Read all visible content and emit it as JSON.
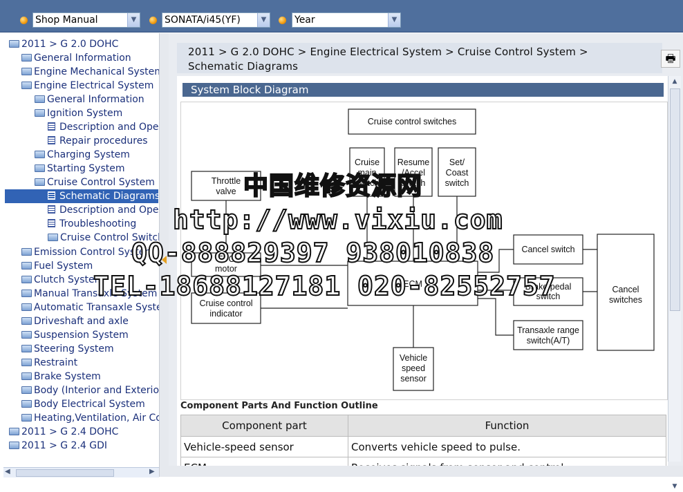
{
  "toolbar": {
    "manual_select": "Shop Manual",
    "model_select": "SONATA/i45(YF)",
    "year_select": "Year"
  },
  "tree": [
    {
      "label": "2011 > G 2.0 DOHC",
      "icon": "folder-icon"
    },
    {
      "label": "General Information",
      "icon": "folder-icon"
    },
    {
      "label": "Engine Mechanical System",
      "icon": "folder-icon"
    },
    {
      "label": "Engine Electrical System",
      "icon": "folder-open-icon"
    },
    {
      "label": "General Information",
      "icon": "folder-icon"
    },
    {
      "label": "Ignition System",
      "icon": "folder-open-icon"
    },
    {
      "label": "Description and Oper",
      "icon": "document-icon"
    },
    {
      "label": "Repair procedures",
      "icon": "document-icon"
    },
    {
      "label": "Charging System",
      "icon": "folder-icon"
    },
    {
      "label": "Starting System",
      "icon": "folder-icon"
    },
    {
      "label": "Cruise Control System",
      "icon": "folder-open-icon"
    },
    {
      "label": "Schematic Diagrams",
      "icon": "document-icon"
    },
    {
      "label": "Description and Oper",
      "icon": "document-icon"
    },
    {
      "label": "Troubleshooting",
      "icon": "document-icon"
    },
    {
      "label": "Cruise Control Switch",
      "icon": "folder-icon"
    },
    {
      "label": "Emission Control System",
      "icon": "folder-icon"
    },
    {
      "label": "Fuel System",
      "icon": "folder-icon"
    },
    {
      "label": "Clutch System",
      "icon": "folder-icon"
    },
    {
      "label": "Manual Transaxle System",
      "icon": "folder-icon"
    },
    {
      "label": "Automatic Transaxle System",
      "icon": "folder-icon"
    },
    {
      "label": "Driveshaft and axle",
      "icon": "folder-icon"
    },
    {
      "label": "Suspension System",
      "icon": "folder-icon"
    },
    {
      "label": "Steering System",
      "icon": "folder-icon"
    },
    {
      "label": "Restraint",
      "icon": "folder-icon"
    },
    {
      "label": "Brake System",
      "icon": "folder-icon"
    },
    {
      "label": "Body (Interior and Exterior)",
      "icon": "folder-icon"
    },
    {
      "label": "Body Electrical System",
      "icon": "folder-icon"
    },
    {
      "label": "Heating,Ventilation, Air Co",
      "icon": "folder-icon"
    },
    {
      "label": "2011 > G 2.4 DOHC",
      "icon": "folder-icon"
    },
    {
      "label": "2011 > G 2.4 GDI",
      "icon": "folder-icon"
    }
  ],
  "breadcrumb": {
    "line1": "2011 > G 2.0 DOHC > Engine Electrical System > Cruise Control System >",
    "line2": "Schematic Diagrams"
  },
  "section_title": "System Block Diagram",
  "diagram": {
    "cruise_control_switches": "Cruise control switches",
    "cruise_main": [
      "Cruise",
      "main",
      "switch"
    ],
    "resume_accel": [
      "Resume",
      "/Accel",
      "switch"
    ],
    "set_coast": [
      "Set/",
      "Coast",
      "switch"
    ],
    "throttle_valve": [
      "Throttle",
      "valve"
    ],
    "etc_motor": [
      "ETC",
      "motor"
    ],
    "ecm": "ECM",
    "cruise_indicator": [
      "Cruise control",
      "indicator"
    ],
    "cancel_switch": "Cancel switch",
    "brake_pedal": [
      "Brake pedal",
      "switch"
    ],
    "transaxle_range": [
      "Transaxle range",
      "switch(A/T)"
    ],
    "cancel_switches": [
      "Cancel",
      "switches"
    ],
    "vehicle_speed": [
      "Vehicle",
      "speed",
      "sensor"
    ]
  },
  "watermark": {
    "line1": "中国维修资源网",
    "line2": "http://www.vixiu.com",
    "line3": "QQ-888829397 938010838",
    "line4": "TEL-18688127181 020-82552757"
  },
  "outline_title": "Component Parts And Function Outline",
  "table": {
    "headers": [
      "Component part",
      "Function"
    ],
    "rows": [
      [
        "Vehicle-speed sensor",
        "Converts vehicle speed to pulse."
      ],
      [
        "ECM",
        "Receives signals from sensor and control"
      ]
    ]
  }
}
